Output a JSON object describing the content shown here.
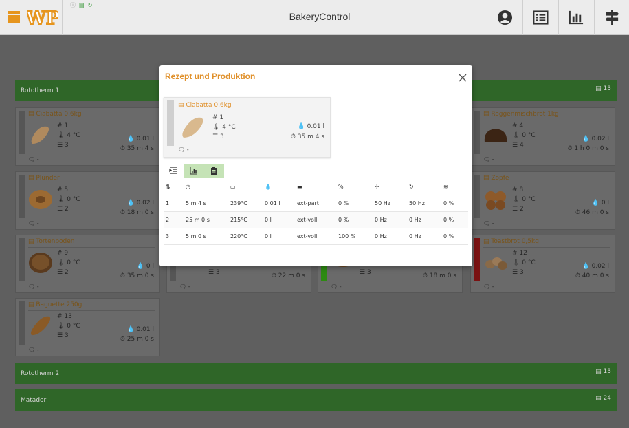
{
  "app": {
    "title": "BakeryControl"
  },
  "header": {
    "logo_text": "WP"
  },
  "colors": {
    "accent": "#e0902a",
    "group_bar": "#2f6628",
    "status_green": "#2d8a12",
    "status_red": "#7a1212"
  },
  "groups": [
    {
      "name": "Rototherm 1",
      "count": "13"
    },
    {
      "name": "Rototherm 2",
      "count": "13"
    },
    {
      "name": "Matador",
      "count": "24"
    }
  ],
  "cards": [
    {
      "name": "Ciabatta 0,6kg",
      "num": "1",
      "temp": "4 °C",
      "steps": "3",
      "water": "0.01 l",
      "time": "35 m 4 s",
      "comment": "-"
    },
    {
      "name": "Plunder",
      "num": "5",
      "temp": "0 °C",
      "steps": "2",
      "water": "0.02 l",
      "time": "18 m 0 s",
      "comment": "-"
    },
    {
      "name": "Tortenboden",
      "num": "9",
      "temp": "0 °C",
      "steps": "2",
      "water": "0 l",
      "time": "35 m 0 s",
      "comment": "-"
    },
    {
      "name": "Baguette 250g",
      "num": "13",
      "temp": "0 °C",
      "steps": "3",
      "water": "0.01 l",
      "time": "25 m 0 s",
      "comment": "-"
    },
    {
      "name": "Roggenmischbrot 1kg",
      "num": "4",
      "temp": "0 °C",
      "steps": "4",
      "water": "0.02 l",
      "time": "1 h 0 m 0 s",
      "comment": "-"
    },
    {
      "name": "Zöpfe",
      "num": "8",
      "temp": "0 °C",
      "steps": "2",
      "water": "0 l",
      "time": "46 m 0 s",
      "comment": "-"
    },
    {
      "name": "Toastbrot 0,5kg",
      "num": "12",
      "temp": "0 °C",
      "steps": "3",
      "water": "0.02 l",
      "time": "40 m 0 s",
      "comment": "-"
    },
    {
      "steps": "3",
      "time": "22 m 0 s",
      "comment": "-"
    },
    {
      "steps": "3",
      "time": "18 m 0 s",
      "comment": "-"
    }
  ],
  "modal": {
    "title": "Rezept und Produktion",
    "card": {
      "name": "Ciabatta 0,6kg",
      "num": "1",
      "temp": "4 °C",
      "steps": "3",
      "water": "0.01 l",
      "time": "35 m 4 s",
      "comment": "-"
    },
    "rows": [
      [
        "1",
        "5 m 4 s",
        "239°C",
        "0.01 l",
        "ext-part",
        "0 %",
        "50 Hz",
        "50 Hz",
        "0 %"
      ],
      [
        "2",
        "25 m 0 s",
        "215°C",
        "0 l",
        "ext-voll",
        "0 %",
        "0 Hz",
        "0 Hz",
        "0 %"
      ],
      [
        "3",
        "5 m 0 s",
        "220°C",
        "0 l",
        "ext-voll",
        "100 %",
        "0 Hz",
        "0 Hz",
        "0 %"
      ]
    ]
  }
}
